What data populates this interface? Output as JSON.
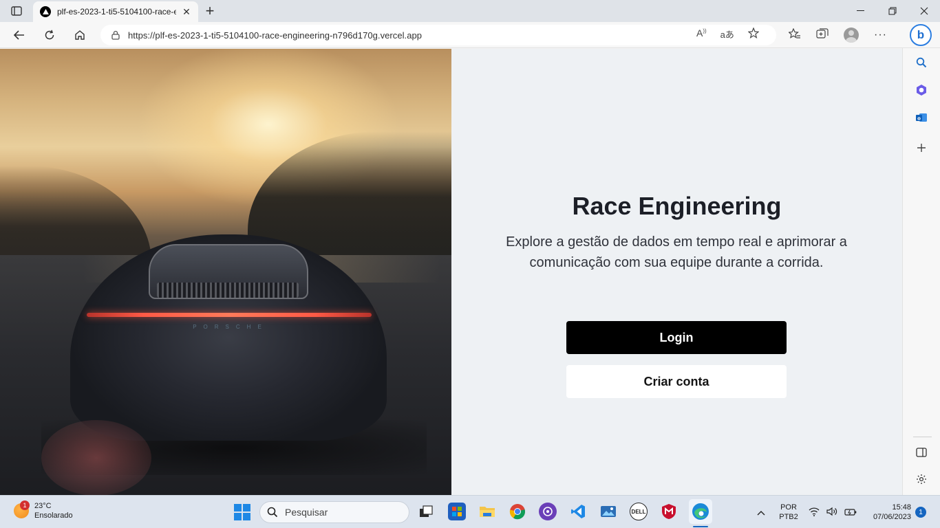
{
  "browser": {
    "tab_title": "plf-es-2023-1-ti5-5104100-race-e",
    "url": "https://plf-es-2023-1-ti5-5104100-race-engineering-n796d170g.vercel.app",
    "new_tab_glyph": "+",
    "tab_close_glyph": "✕"
  },
  "page": {
    "title": "Race Engineering",
    "description": "Explore a gestão de dados em tempo real e aprimorar a comunicação com sua equipe durante a corrida.",
    "login_label": "Login",
    "create_account_label": "Criar conta",
    "car_badge": "PORSCHE"
  },
  "taskbar": {
    "weather_temp": "23°C",
    "weather_desc": "Ensolarado",
    "weather_badge": "1",
    "search_placeholder": "Pesquisar",
    "language": "POR",
    "layout": "PTB2",
    "time": "15:48",
    "date": "07/06/2023",
    "notifications": "1"
  }
}
